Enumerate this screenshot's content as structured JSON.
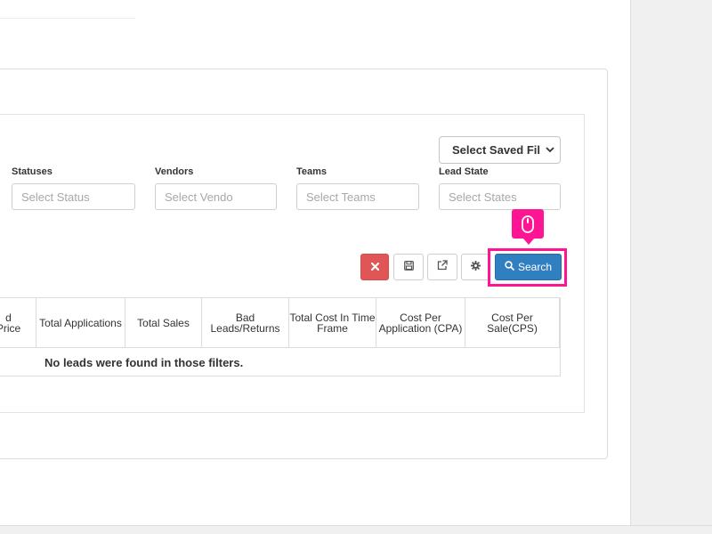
{
  "saved_filter": {
    "label": "Select Saved Fil"
  },
  "filters": [
    {
      "label": "Statuses",
      "placeholder": "Select Status"
    },
    {
      "label": "Vendors",
      "placeholder": "Select Vendo"
    },
    {
      "label": "Teams",
      "placeholder": "Select Teams"
    },
    {
      "label": "Lead State",
      "placeholder": "Select States"
    }
  ],
  "toolbar": {
    "clear_icon": "close-icon",
    "save_icon": "floppy-disk-icon",
    "export_icon": "external-link-icon",
    "settings_icon": "gear-icon",
    "search_label": "Search",
    "search_icon": "search-icon"
  },
  "table": {
    "headers": [
      "d Price",
      "Total Applications",
      "Total Sales",
      "Bad Leads/Returns",
      "Total Cost In Time Frame",
      "Cost Per Application (CPA)",
      "Cost Per Sale(CPS)"
    ],
    "empty_message": "No leads were found in those filters."
  },
  "colors": {
    "primary": "#2f7fc1",
    "danger": "#e05556",
    "highlight": "#ff1493"
  }
}
